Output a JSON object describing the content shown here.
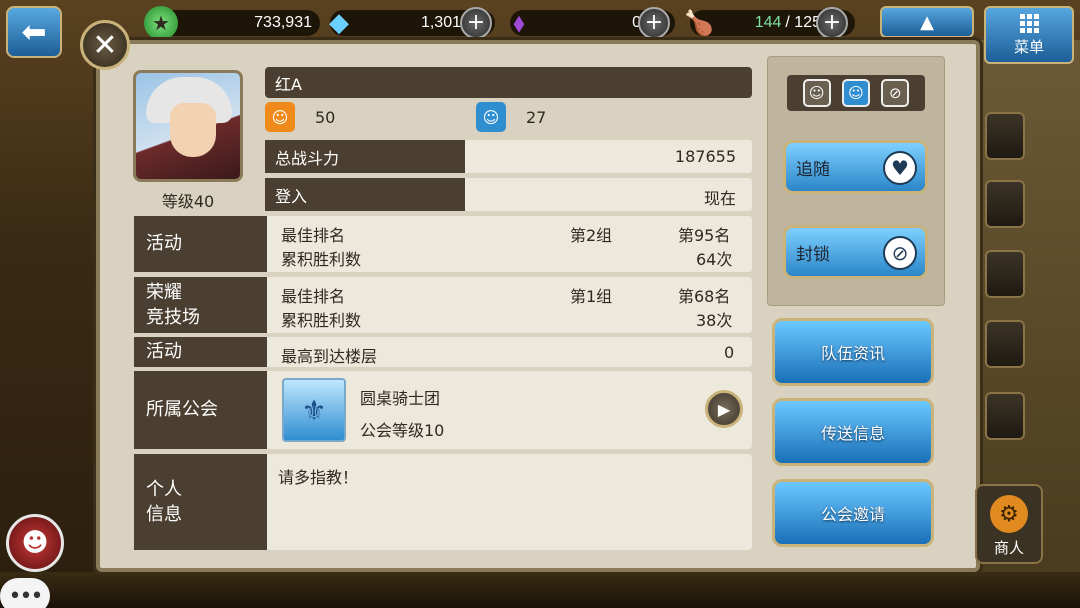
{
  "topbar": {
    "gold": "733,931",
    "gems": "1,301",
    "crystals": "0",
    "stamina_current": "144",
    "stamina_sep": "/ 125",
    "menu_label": "菜单"
  },
  "profile": {
    "name": "红A",
    "level_label": "等级40",
    "stat_orange": "50",
    "stat_blue": "27"
  },
  "rows": {
    "power_label": "总战斗力",
    "power_value": "187655",
    "login_label": "登入",
    "login_value": "现在"
  },
  "activity1": {
    "category": "活动",
    "best_rank_label": "最佳排名",
    "best_rank_group": "第2组",
    "best_rank_value": "第95名",
    "wins_label": "累积胜利数",
    "wins_value": "64次"
  },
  "arena": {
    "category_line1": "荣耀",
    "category_line2": "竞技场",
    "best_rank_label": "最佳排名",
    "best_rank_group": "第1组",
    "best_rank_value": "第68名",
    "wins_label": "累积胜利数",
    "wins_value": "38次"
  },
  "activity2": {
    "category": "活动",
    "floor_label": "最高到达楼层",
    "floor_value": "0"
  },
  "guild": {
    "category": "所属公会",
    "name": "圆桌骑士团",
    "level": "公会等级10"
  },
  "personal": {
    "category_line1": "个人",
    "category_line2": "信息",
    "message": "请多指教！"
  },
  "actions": {
    "follow_label": "追随",
    "block_label": "封锁",
    "team_info_label": "队伍资讯",
    "send_message_label": "传送信息",
    "guild_invite_label": "公会邀请"
  },
  "side": {
    "merchant_label": "商人"
  },
  "colors": {
    "panel_bg": "#d9d2c0",
    "label_bg": "#4a3f30",
    "accent_blue": "#2b86c8",
    "stamina_green": "#7fe0a0"
  }
}
